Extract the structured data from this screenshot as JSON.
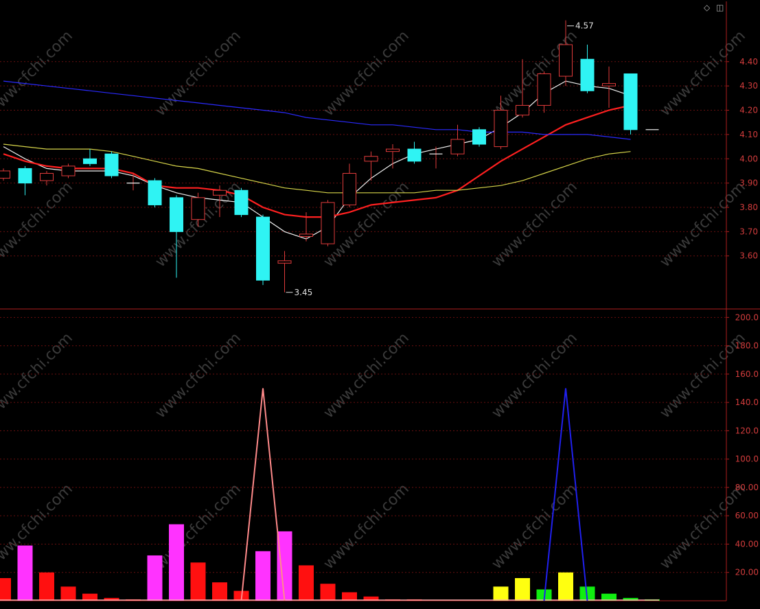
{
  "toolbar": {
    "diamond_icon": "diamond-icon",
    "window_icon": "window-toggle-icon"
  },
  "watermark": "www.cfchi.com",
  "colors": {
    "background": "#000000",
    "grid": "#6b0f0f",
    "axis": "#b01e1e",
    "up_candle": "#e23b3b",
    "down_candle": "#2ff3f3",
    "ma_white": "#f2f2f2",
    "ma_red": "#ff2020",
    "ma_yellow": "#d8d64a",
    "ma_blue": "#2a2aff",
    "bar_magenta": "#ff33ff",
    "bar_red": "#ff1010",
    "bar_yellow": "#ffff10",
    "bar_green": "#10ee10",
    "peak_pink": "#ff8a8a",
    "peak_blue": "#2020ee"
  },
  "chart_data": [
    {
      "type": "candlestick",
      "y_ticks": [
        "3.60",
        "3.70",
        "3.80",
        "3.90",
        "4.00",
        "4.10",
        "4.20",
        "4.30",
        "4.40"
      ],
      "ylim": [
        3.39,
        4.62
      ],
      "annotations": {
        "high": "4.57",
        "low": "3.45"
      },
      "candles": [
        {
          "o": 3.92,
          "c": 3.95,
          "h": 3.96,
          "l": 3.91
        },
        {
          "o": 3.96,
          "c": 3.9,
          "h": 3.97,
          "l": 3.85
        },
        {
          "o": 3.91,
          "c": 3.94,
          "h": 3.95,
          "l": 3.89
        },
        {
          "o": 3.93,
          "c": 3.97,
          "h": 3.98,
          "l": 3.92
        },
        {
          "o": 4.0,
          "c": 3.98,
          "h": 4.04,
          "l": 3.97
        },
        {
          "o": 4.02,
          "c": 3.93,
          "h": 4.03,
          "l": 3.92
        },
        {
          "o": 3.9,
          "c": 3.9,
          "h": 3.94,
          "l": 3.87
        },
        {
          "o": 3.91,
          "c": 3.81,
          "h": 3.92,
          "l": 3.8
        },
        {
          "o": 3.84,
          "c": 3.7,
          "h": 3.85,
          "l": 3.51
        },
        {
          "o": 3.75,
          "c": 3.84,
          "h": 3.86,
          "l": 3.72
        },
        {
          "o": 3.85,
          "c": 3.87,
          "h": 3.89,
          "l": 3.76
        },
        {
          "o": 3.87,
          "c": 3.77,
          "h": 3.88,
          "l": 3.76
        },
        {
          "o": 3.76,
          "c": 3.5,
          "h": 3.77,
          "l": 3.48
        },
        {
          "o": 3.57,
          "c": 3.58,
          "h": 3.62,
          "l": 3.45
        },
        {
          "o": 3.68,
          "c": 3.69,
          "h": 3.78,
          "l": 3.66
        },
        {
          "o": 3.65,
          "c": 3.82,
          "h": 3.83,
          "l": 3.64
        },
        {
          "o": 3.81,
          "c": 3.94,
          "h": 3.98,
          "l": 3.8
        },
        {
          "o": 3.99,
          "c": 4.01,
          "h": 4.03,
          "l": 3.91
        },
        {
          "o": 4.03,
          "c": 4.04,
          "h": 4.06,
          "l": 3.96
        },
        {
          "o": 4.04,
          "c": 3.99,
          "h": 4.07,
          "l": 3.98
        },
        {
          "o": 4.02,
          "c": 4.02,
          "h": 4.05,
          "l": 3.96
        },
        {
          "o": 4.02,
          "c": 4.08,
          "h": 4.14,
          "l": 4.01
        },
        {
          "o": 4.12,
          "c": 4.06,
          "h": 4.13,
          "l": 4.05
        },
        {
          "o": 4.05,
          "c": 4.2,
          "h": 4.26,
          "l": 4.04
        },
        {
          "o": 4.18,
          "c": 4.22,
          "h": 4.41,
          "l": 4.17
        },
        {
          "o": 4.22,
          "c": 4.35,
          "h": 4.36,
          "l": 4.19
        },
        {
          "o": 4.34,
          "c": 4.47,
          "h": 4.57,
          "l": 4.3
        },
        {
          "o": 4.41,
          "c": 4.28,
          "h": 4.47,
          "l": 4.27
        },
        {
          "o": 4.3,
          "c": 4.31,
          "h": 4.38,
          "l": 4.21
        },
        {
          "o": 4.35,
          "c": 4.12,
          "h": 4.35,
          "l": 4.1
        },
        {
          "o": 4.12,
          "c": 4.12,
          "h": 4.12,
          "l": 4.12
        }
      ],
      "series": [
        {
          "color": "#f2f2f2",
          "values": [
            4.05,
            4.0,
            3.96,
            3.95,
            3.95,
            3.95,
            3.93,
            3.89,
            3.86,
            3.84,
            3.83,
            3.82,
            3.76,
            3.7,
            3.67,
            3.72,
            3.84,
            3.92,
            3.98,
            4.02,
            4.04,
            4.06,
            4.08,
            4.13,
            4.19,
            4.27,
            4.32,
            4.3,
            4.29,
            4.26
          ]
        },
        {
          "color": "#ff2020",
          "values": [
            4.02,
            3.99,
            3.97,
            3.96,
            3.96,
            3.96,
            3.94,
            3.89,
            3.88,
            3.88,
            3.87,
            3.85,
            3.8,
            3.77,
            3.76,
            3.76,
            3.78,
            3.81,
            3.82,
            3.83,
            3.84,
            3.87,
            3.93,
            3.99,
            4.04,
            4.09,
            4.14,
            4.17,
            4.2,
            4.22
          ]
        },
        {
          "color": "#d8d64a",
          "values": [
            4.06,
            4.05,
            4.04,
            4.04,
            4.04,
            4.03,
            4.01,
            3.99,
            3.97,
            3.96,
            3.94,
            3.92,
            3.9,
            3.88,
            3.87,
            3.86,
            3.86,
            3.86,
            3.86,
            3.86,
            3.87,
            3.87,
            3.88,
            3.89,
            3.91,
            3.94,
            3.97,
            4.0,
            4.02,
            4.03
          ]
        },
        {
          "color": "#2a2aff",
          "values": [
            4.32,
            4.31,
            4.3,
            4.29,
            4.28,
            4.27,
            4.26,
            4.25,
            4.24,
            4.23,
            4.22,
            4.21,
            4.2,
            4.19,
            4.17,
            4.16,
            4.15,
            4.14,
            4.14,
            4.13,
            4.12,
            4.12,
            4.11,
            4.11,
            4.11,
            4.1,
            4.1,
            4.1,
            4.09,
            4.08
          ]
        }
      ]
    },
    {
      "type": "bar",
      "y_ticks": [
        "20.00",
        "40.00",
        "60.00",
        "80.00",
        "100.0",
        "120.0",
        "140.0",
        "160.0",
        "180.0",
        "200.0"
      ],
      "ylim": [
        0,
        205
      ],
      "bars": [
        {
          "v": 16,
          "color": "#ff1010"
        },
        {
          "v": 39,
          "color": "#ff33ff"
        },
        {
          "v": 20,
          "color": "#ff1010"
        },
        {
          "v": 10,
          "color": "#ff1010"
        },
        {
          "v": 5,
          "color": "#ff1010"
        },
        {
          "v": 2,
          "color": "#ff1010"
        },
        {
          "v": 1,
          "color": "#ff1010"
        },
        {
          "v": 32,
          "color": "#ff33ff"
        },
        {
          "v": 54,
          "color": "#ff33ff"
        },
        {
          "v": 27,
          "color": "#ff1010"
        },
        {
          "v": 13,
          "color": "#ff1010"
        },
        {
          "v": 7,
          "color": "#ff1010"
        },
        {
          "v": 35,
          "color": "#ff33ff"
        },
        {
          "v": 49,
          "color": "#ff33ff"
        },
        {
          "v": 25,
          "color": "#ff1010"
        },
        {
          "v": 12,
          "color": "#ff1010"
        },
        {
          "v": 6,
          "color": "#ff1010"
        },
        {
          "v": 3,
          "color": "#ff1010"
        },
        {
          "v": 1,
          "color": "#ff1010"
        },
        {
          "v": 1,
          "color": "#ff1010"
        },
        {
          "v": 0,
          "color": "#ff1010"
        },
        {
          "v": 0,
          "color": "#ff1010"
        },
        {
          "v": 0,
          "color": "#ff1010"
        },
        {
          "v": 10,
          "color": "#ffff10"
        },
        {
          "v": 16,
          "color": "#ffff10"
        },
        {
          "v": 8,
          "color": "#10ee10"
        },
        {
          "v": 20,
          "color": "#ffff10"
        },
        {
          "v": 10,
          "color": "#10ee10"
        },
        {
          "v": 5,
          "color": "#10ee10"
        },
        {
          "v": 2,
          "color": "#10ee10"
        },
        {
          "v": 1,
          "color": "#10ee10"
        }
      ],
      "peaks": [
        {
          "color": "#ff8a8a",
          "points": [
            [
              11,
              0
            ],
            [
              12,
              150
            ],
            [
              13,
              0
            ]
          ]
        },
        {
          "color": "#2020ee",
          "points": [
            [
              25,
              0
            ],
            [
              26,
              150
            ],
            [
              27,
              0
            ]
          ]
        }
      ]
    }
  ]
}
